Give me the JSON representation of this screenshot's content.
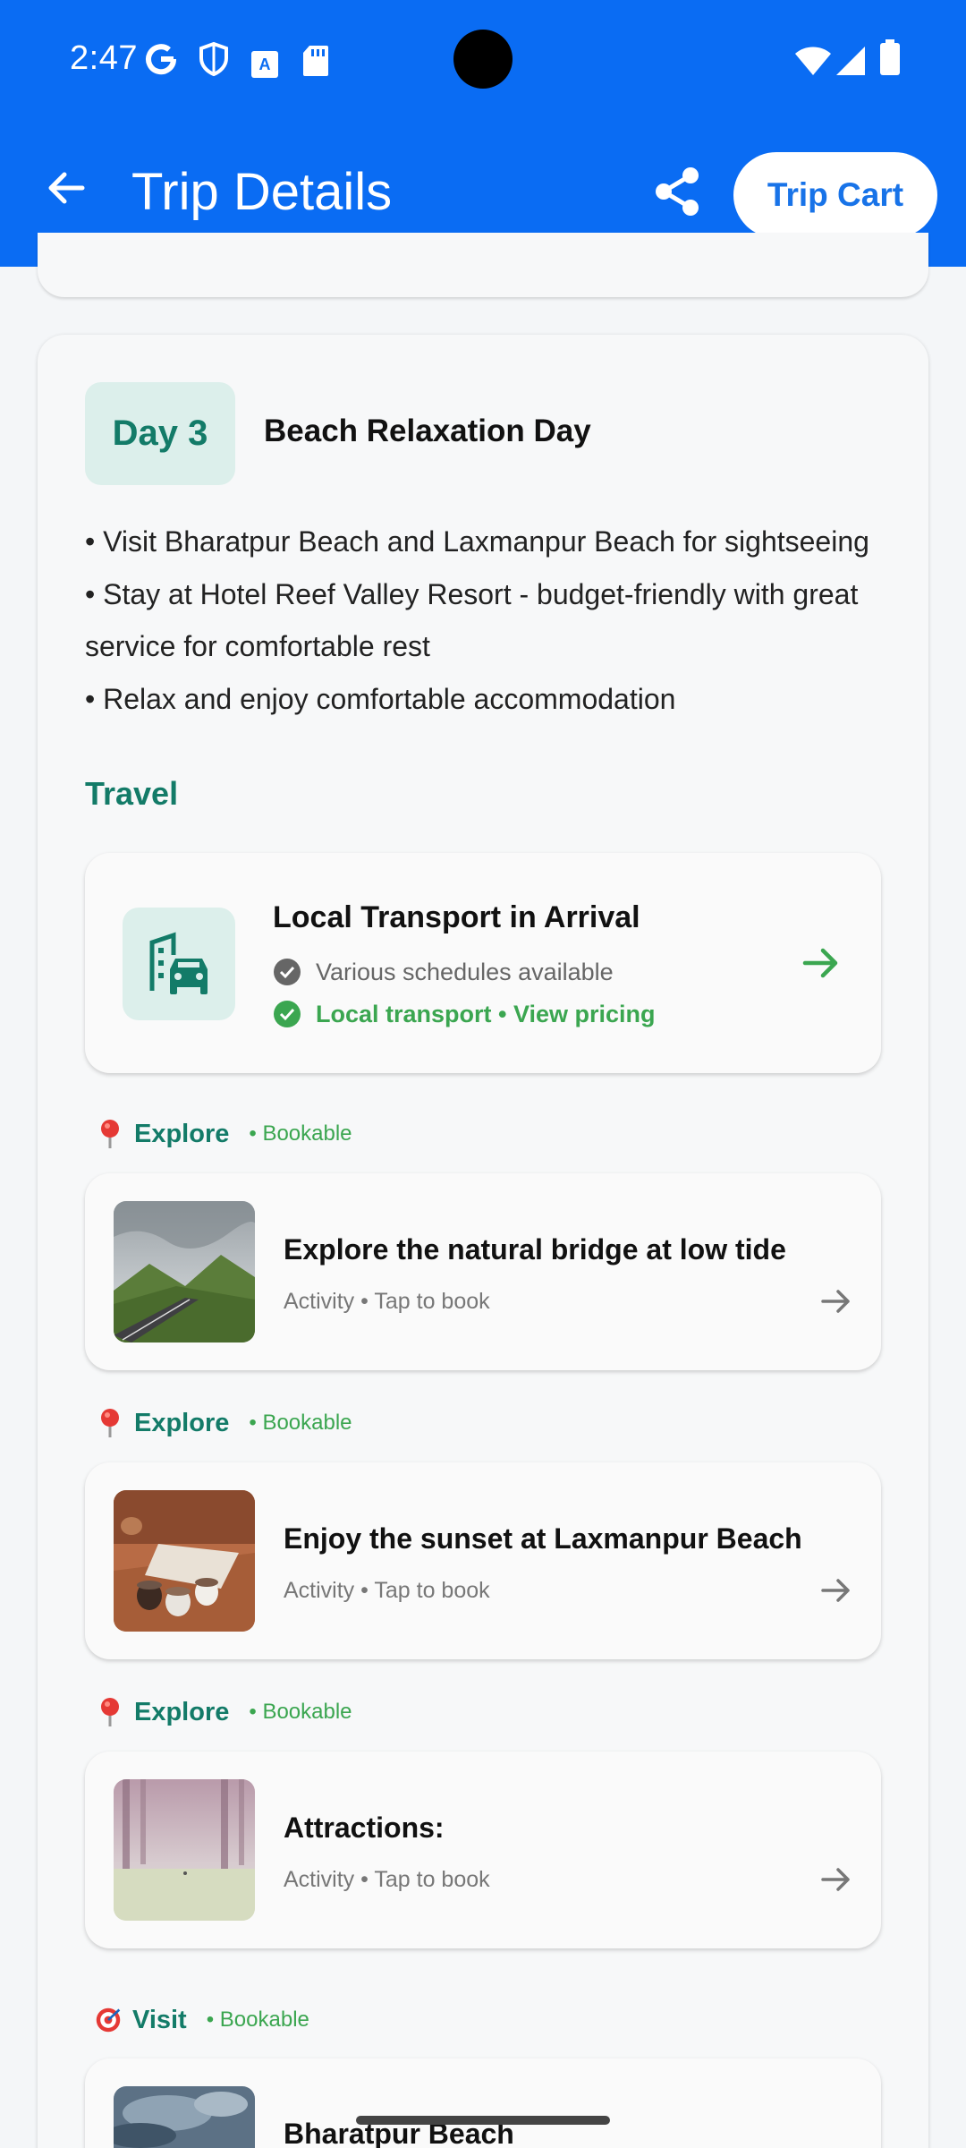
{
  "status_bar": {
    "time": "2:47"
  },
  "app_bar": {
    "title": "Trip Details",
    "cart_label": "Trip Cart"
  },
  "day": {
    "badge": "Day 3",
    "title": "Beach Relaxation Day",
    "bullets": [
      "• Visit Bharatpur Beach and Laxmanpur Beach for sightseeing",
      "• Stay at Hotel Reef Valley Resort - budget-friendly with great service for comfortable rest",
      "• Relax and enjoy comfortable accommodation"
    ]
  },
  "travel": {
    "heading": "Travel",
    "card": {
      "title": "Local Transport in Arrival",
      "line1": "Various schedules available",
      "line2": "Local transport • View pricing"
    }
  },
  "sections": [
    {
      "label": "Explore",
      "tag": "• Bookable",
      "title": "Explore the natural bridge at low tide",
      "subtitle": "Activity • Tap to book"
    },
    {
      "label": "Explore",
      "tag": "• Bookable",
      "title": "Enjoy the sunset at Laxmanpur Beach",
      "subtitle": "Activity • Tap to book"
    },
    {
      "label": "Explore",
      "tag": "• Bookable",
      "title": "Attractions:",
      "subtitle": "Activity • Tap to book"
    },
    {
      "label": "Visit",
      "tag": "• Bookable",
      "title": "Bharatpur Beach"
    }
  ],
  "colors": {
    "app_bar": "#0a6cf3",
    "accent_teal": "#137b68",
    "accent_green": "#3ba650"
  }
}
